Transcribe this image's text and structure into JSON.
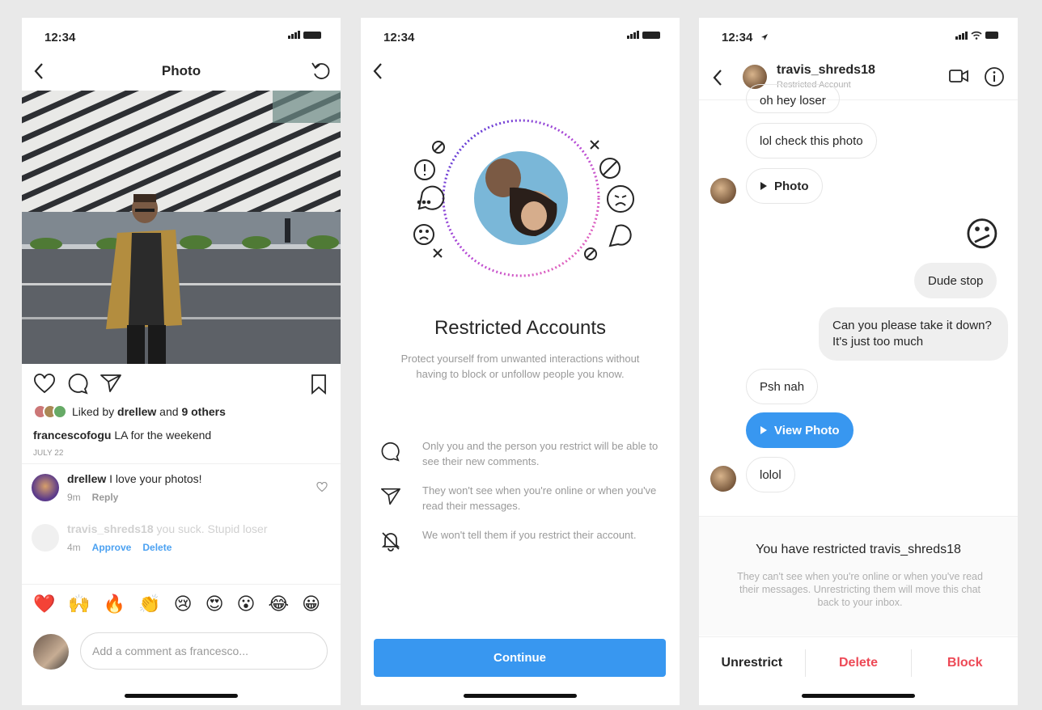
{
  "status": {
    "time1": "12:34",
    "time2": "12:34",
    "time3": "12:34"
  },
  "p1": {
    "title": "Photo",
    "liked_prefix": "Liked by ",
    "liked_user": "drellew",
    "liked_and": " and ",
    "liked_others": "9 others",
    "caption_user": "francescofogu",
    "caption_text": " LA for the weekend",
    "date": "JULY 22",
    "comment1": {
      "user": "drellew",
      "text": " I love your photos!",
      "time": "9m",
      "reply": "Reply"
    },
    "comment2": {
      "user": "travis_shreds18",
      "text": " you suck. Stupid loser",
      "time": "4m",
      "approve": "Approve",
      "delete": "Delete"
    },
    "emojis": [
      "❤️",
      "🙌",
      "🔥",
      "👏",
      "😢",
      "😍",
      "😮",
      "😂",
      "😀"
    ],
    "input_placeholder": "Add a comment as francesco..."
  },
  "p2": {
    "heading": "Restricted Accounts",
    "sub": "Protect yourself from unwanted interactions without having to block or unfollow people you know.",
    "features": [
      "Only you and the person you restrict will be able to see their new comments.",
      "They won't see when you're online or when you've read their messages.",
      "We won't tell them if you restrict their account."
    ],
    "continue": "Continue"
  },
  "p3": {
    "name": "travis_shreds18",
    "sub": "Restricted Account",
    "messages": {
      "m0": "oh hey loser",
      "m1": "lol check this photo",
      "m2": "Photo",
      "m3": "😕",
      "m4": "Dude stop",
      "m5": "Can you please take it down? It's just too much",
      "m6": "Psh nah",
      "m7": "View Photo",
      "m8": "lolol"
    },
    "restrict_title": "You have restricted travis_shreds18",
    "restrict_sub": "They can't see when you're online or when you've read their messages. Unrestricting them will move this chat back to your inbox.",
    "actions": {
      "unrestrict": "Unrestrict",
      "delete": "Delete",
      "block": "Block"
    }
  },
  "colors": {
    "accent": "#3897f0",
    "danger": "#ed4956",
    "muted": "#999999"
  }
}
